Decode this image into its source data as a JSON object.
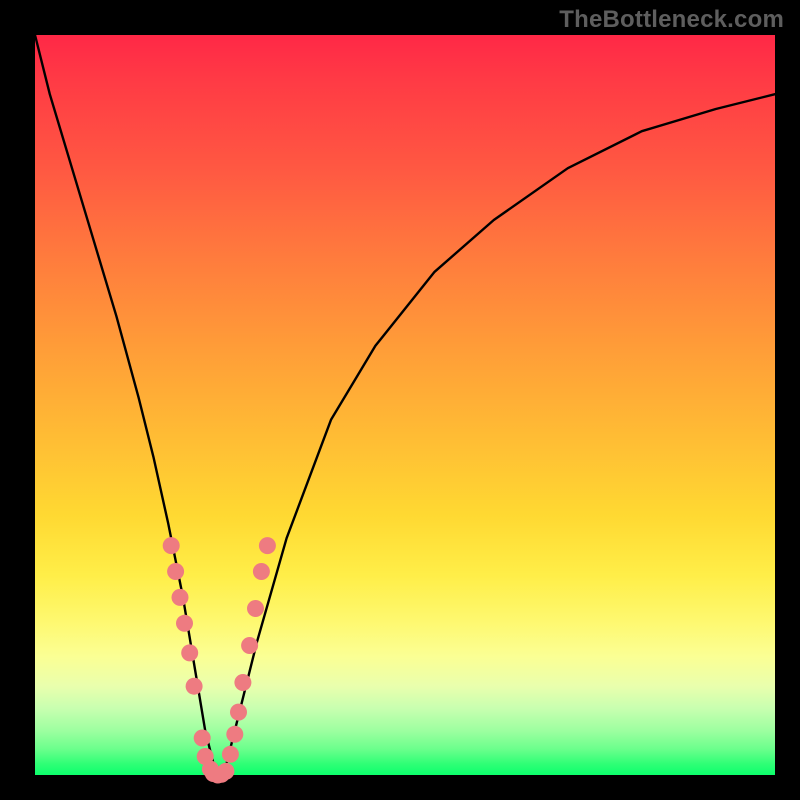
{
  "watermark": {
    "text": "TheBottleneck.com"
  },
  "chart_data": {
    "type": "line",
    "title": "",
    "xlabel": "",
    "ylabel": "",
    "xlim": [
      0,
      100
    ],
    "ylim": [
      0,
      100
    ],
    "grid": false,
    "legend": false,
    "series": [
      {
        "name": "bottleneck-curve",
        "color": "#000000",
        "x": [
          0,
          2,
          5,
          8,
          11,
          14,
          16,
          18,
          20,
          21.5,
          23,
          24.5,
          25.5,
          27,
          30,
          34,
          40,
          46,
          54,
          62,
          72,
          82,
          92,
          100
        ],
        "y": [
          100,
          92,
          82,
          72,
          62,
          51,
          43,
          34,
          24,
          15,
          6,
          0,
          0,
          6,
          18,
          32,
          48,
          58,
          68,
          75,
          82,
          87,
          90,
          92
        ]
      }
    ],
    "markers": {
      "name": "highlighted-segment",
      "color": "#ee7b81",
      "x": [
        18.4,
        19.0,
        19.6,
        20.2,
        20.9,
        21.5,
        22.6,
        23.0,
        23.7,
        24.1,
        24.7,
        25.2,
        25.8,
        26.4,
        27.0,
        27.5,
        28.1,
        29.0,
        29.8,
        30.6,
        31.4
      ],
      "y": [
        31.0,
        27.5,
        24.0,
        20.5,
        16.5,
        12.0,
        5.0,
        2.5,
        0.8,
        0.2,
        0.0,
        0.1,
        0.5,
        2.8,
        5.5,
        8.5,
        12.5,
        17.5,
        22.5,
        27.5,
        31.0
      ]
    },
    "gradient_stops": [
      {
        "pos": 0.0,
        "color": "#ff2846"
      },
      {
        "pos": 0.3,
        "color": "#ff7b3d"
      },
      {
        "pos": 0.55,
        "color": "#ffbe34"
      },
      {
        "pos": 0.75,
        "color": "#ffee48"
      },
      {
        "pos": 0.9,
        "color": "#c8ffb0"
      },
      {
        "pos": 1.0,
        "color": "#0cff6c"
      }
    ]
  }
}
